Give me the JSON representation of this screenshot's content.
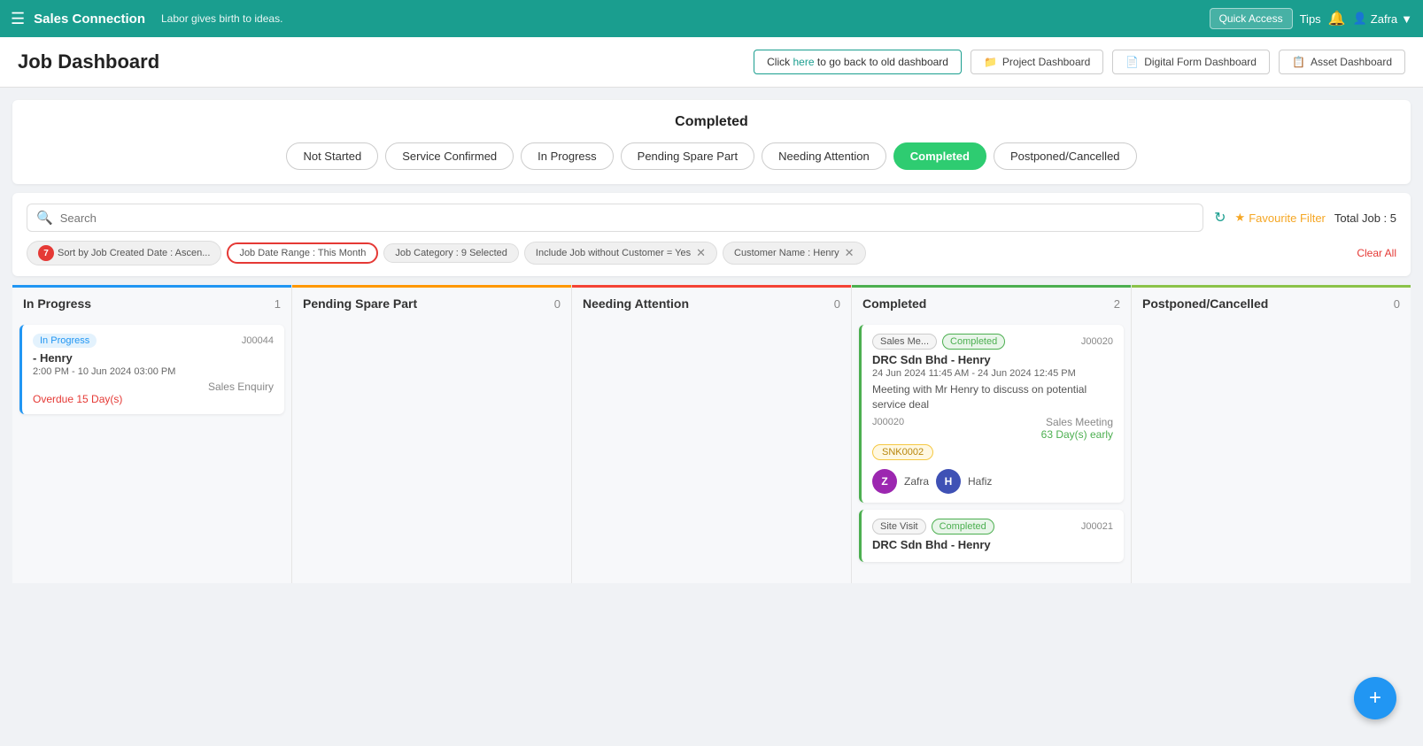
{
  "topnav": {
    "brand": "Sales Connection",
    "tagline": "Labor gives birth to ideas.",
    "quick_access": "Quick Access",
    "tips": "Tips",
    "user": "Zafra",
    "hamburger_icon": "☰",
    "bell_icon": "🔔",
    "chevron_icon": "▼",
    "user_icon": "👤"
  },
  "page_header": {
    "title": "Job Dashboard",
    "back_link_text": "Click",
    "back_link_anchor": "here",
    "back_link_suffix": "to go back to old dashboard",
    "project_dashboard": "Project Dashboard",
    "digital_form_dashboard": "Digital Form Dashboard",
    "asset_dashboard": "Asset Dashboard",
    "folder_icon": "📁",
    "form_icon": "📄",
    "asset_icon": "📋"
  },
  "status_panel": {
    "title": "Completed",
    "tabs": [
      {
        "label": "Not Started",
        "active": false
      },
      {
        "label": "Service Confirmed",
        "active": false
      },
      {
        "label": "In Progress",
        "active": false
      },
      {
        "label": "Pending Spare Part",
        "active": false
      },
      {
        "label": "Needing Attention",
        "active": false
      },
      {
        "label": "Completed",
        "active": true
      },
      {
        "label": "Postponed/Cancelled",
        "active": false
      }
    ]
  },
  "search": {
    "placeholder": "Search",
    "total_jobs_label": "Total Job : 5",
    "fav_filter_label": "Favourite Filter",
    "star_icon": "★",
    "refresh_icon": "↻"
  },
  "filters": {
    "sort_chip": "Sort by Job Created Date : Ascen...",
    "sort_badge": "7",
    "date_range_chip": "Job Date Range : This Month",
    "category_chip": "Job Category : 9 Selected",
    "no_customer_chip": "Include Job without Customer = Yes",
    "customer_chip": "Customer Name : Henry",
    "clear_all": "Clear All"
  },
  "kanban": {
    "columns": [
      {
        "id": "in-progress",
        "title": "In Progress",
        "count": 1,
        "color": "blue",
        "cards": [
          {
            "status_badge": "In Progress",
            "badge_class": "badge-inprogress",
            "job_id": "J00044",
            "customer": "- Henry",
            "time": "2:00 PM - 10 Jun 2024 03:00 PM",
            "category": "Sales Enquiry",
            "overdue": "Overdue 15 Day(s)",
            "snk": null,
            "avatars": [],
            "desc": null
          }
        ]
      },
      {
        "id": "pending-spare",
        "title": "Pending Spare Part",
        "count": 0,
        "color": "orange",
        "cards": []
      },
      {
        "id": "needing-attention",
        "title": "Needing Attention",
        "count": 0,
        "color": "red",
        "cards": []
      },
      {
        "id": "completed",
        "title": "Completed",
        "count": 2,
        "color": "green",
        "cards": [
          {
            "status_type": "Sales Me...",
            "status_badge": "Completed",
            "badge_class": "badge-completed",
            "job_id": "J00020",
            "customer": "DRC Sdn Bhd - Henry",
            "time": "24 Jun 2024 11:45 AM - 24 Jun 2024 12:45 PM",
            "desc": "Meeting with Mr Henry to discuss on potential service deal",
            "job_id2": "J00020",
            "category": "Sales Meeting",
            "early": "63 Day(s) early",
            "snk": "SNK0002",
            "avatars": [
              {
                "initial": "Z",
                "name": "Zafra",
                "class": "avatar-z"
              },
              {
                "initial": "H",
                "name": "Hafiz",
                "class": "avatar-h"
              }
            ]
          },
          {
            "status_type": "Site Visit",
            "status_badge": "Completed",
            "badge_class": "badge-completed",
            "job_id": "J00021",
            "customer": "DRC Sdn Bhd - Henry",
            "time": "",
            "desc": "",
            "category": "",
            "early": "",
            "snk": null,
            "avatars": []
          }
        ]
      },
      {
        "id": "postponed",
        "title": "Postponed/Cancelled",
        "count": 0,
        "color": "olive",
        "cards": []
      }
    ]
  },
  "fab": {
    "icon": "+"
  }
}
